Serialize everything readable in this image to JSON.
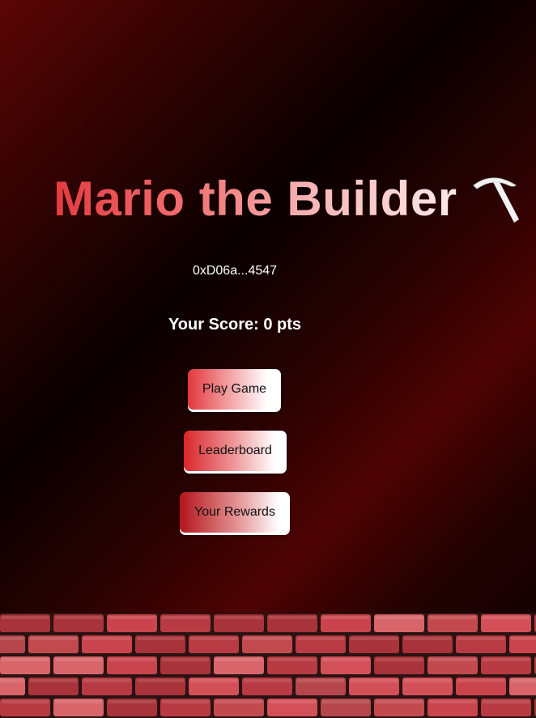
{
  "title": "Mario the Builder",
  "title_icon": "pickaxe-icon",
  "wallet_address": "0xD06a...4547",
  "score_text": "Your Score: 0 pts",
  "menu": {
    "play_label": "Play Game",
    "leaderboard_label": "Leaderboard",
    "rewards_label": "Your Rewards"
  },
  "colors": {
    "background_dark": "#0a0000",
    "background_red": "#5a0505",
    "title_start": "#e33b3f",
    "title_end": "#fde9e9",
    "brick": "#c9444c",
    "mortar": "#2b1212"
  }
}
